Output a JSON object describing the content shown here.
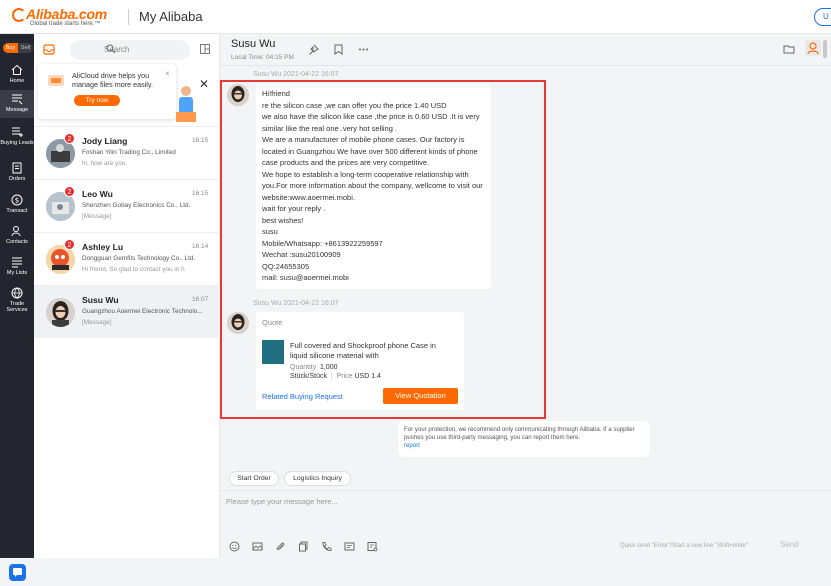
{
  "header": {
    "logo_text": "Alibaba.com",
    "logo_tagline": "Global trade starts here.™",
    "title": "My Alibaba",
    "user_label": "U"
  },
  "nav": {
    "buy": "Buy",
    "sell": "Sell",
    "items": [
      {
        "label": "Home",
        "icon": "home-icon"
      },
      {
        "label": "Message",
        "icon": "message-icon"
      },
      {
        "label": "Buying Leads",
        "icon": "buying-leads-icon"
      },
      {
        "label": "Orders",
        "icon": "orders-icon"
      },
      {
        "label": "Transact",
        "icon": "transact-icon"
      },
      {
        "label": "Contacts",
        "icon": "contacts-icon"
      },
      {
        "label": "My Lists",
        "icon": "lists-icon"
      },
      {
        "label": "Trade Services",
        "icon": "globe-icon"
      }
    ]
  },
  "conversations": {
    "search_placeholder": "Search",
    "promo": {
      "text": "AliCloud drive helps you manage files more easily.",
      "button": "Try now",
      "close": "×"
    },
    "promo_close2": "✕",
    "items": [
      {
        "name": "Jody Liang",
        "time": "16:15",
        "company": "Foshan Yilin Trading Co., Limited",
        "message": "hi, how are you.",
        "badge": "2"
      },
      {
        "name": "Leo Wu",
        "time": "16:15",
        "company": "Shenzhen Gobay Electronics Co., Ltd.",
        "message": "[Message]",
        "badge": "2"
      },
      {
        "name": "Ashley Lu",
        "time": "16:14",
        "company": "Dongguan Gemfits Technology Co., Ltd.",
        "message": "Hi friend, So glad to contact you in h",
        "badge": "2"
      },
      {
        "name": "Susu Wu",
        "time": "16:07",
        "company": "Guangzhou Aoermei Electronic Technolo...",
        "message": "[Message]",
        "badge": ""
      }
    ]
  },
  "chat": {
    "name": "Susu Wu",
    "local_time": "Local Time: 04:15 PM",
    "msg1_meta": "Susu Wu  2021-04-22 16:07",
    "msg1_lines": [
      "Hi!friend",
      "re the silicon case ,we can offer you the price 1.40 USD",
      "we also have the silicon like case ,the price is 0.60 USD .It is very",
      "similar like the real one .very hot selling .",
      "We are a manufacturer of mobile phone cases. Our factory is",
      "located in Guangzhou We have over 500 different kinds of phone",
      "case products and the prices are very competitive.",
      "We hope to establish a long-term cooperative relationship with",
      "you.For more information about the company, wellcome to visit our",
      "website:www.aoermei.mobi.",
      "wait for your reply .",
      "best wishes!",
      "susu",
      "Mobile/Whatsapp: +8613922259597",
      "Wechat :susu20100909",
      "QQ:24655305",
      "mail: susu@aoermei.mobi"
    ],
    "msg2_meta": "Susu Wu  2021-04-22 16:07",
    "quote": {
      "title": "Quote",
      "product": "Full covered and Shockproof phone Case in liquid silicone material with",
      "quantity_label": "Quantity",
      "quantity": "1,000",
      "unit": "Stück/Stück",
      "price_label": "Price",
      "price": "USD 1.4",
      "link": "Related Buying Request",
      "button": "View Quotation"
    },
    "notice": "For your protection, we recommend only communicating through Alibaba. If a supplier pushes you use third-party messaging, you can report them here.",
    "notice_link": "report",
    "quick_replies": [
      "Start Order",
      "Logistics Inquiry"
    ],
    "input_placeholder": "Please type your message here...",
    "send_hint": "Quick send \"Enter\"/Start a new line \"Shift+enter\"",
    "send": "Send"
  },
  "colors": {
    "accent": "#ff6a00",
    "link": "#1a73e8",
    "nav_bg": "#23262e",
    "highlight_box": "#e53935"
  }
}
